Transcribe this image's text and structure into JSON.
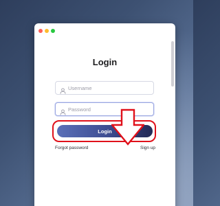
{
  "window": {
    "controls": [
      "close",
      "minimize",
      "maximize"
    ]
  },
  "login": {
    "title": "Login",
    "username": {
      "placeholder": "Username",
      "icon": "user-icon"
    },
    "password": {
      "placeholder": "Password",
      "icon": "user-icon"
    },
    "button_label": "Login",
    "forgot_password": "Forgot password",
    "sign_up": "Sign up"
  },
  "annotation": {
    "arrow_color": "#e0101a",
    "highlight_color": "#e0101a"
  },
  "colors": {
    "button_start": "#5a6fb8",
    "button_end": "#232a56",
    "close": "#ff5f57",
    "minimize": "#febc2e",
    "maximize": "#28c840"
  }
}
